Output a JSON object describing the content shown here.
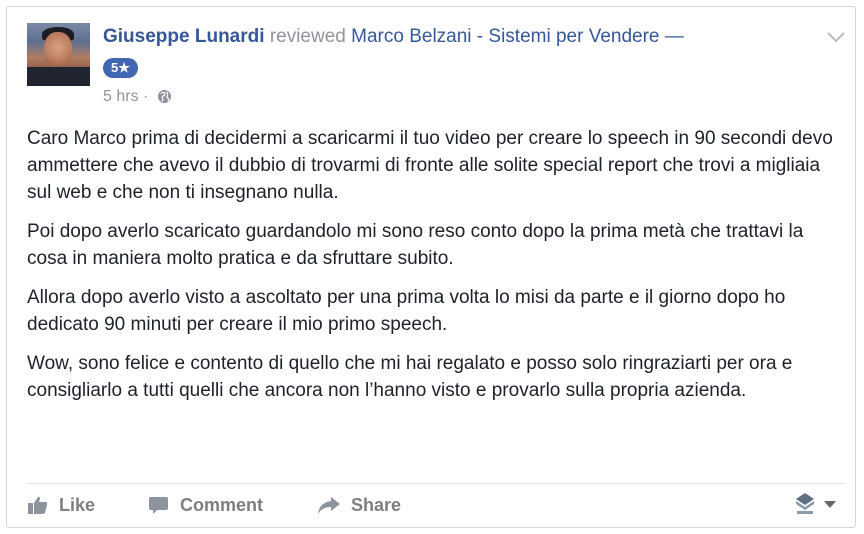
{
  "post": {
    "author": "Giuseppe Lunardi",
    "verb": "reviewed",
    "page_name": "Marco Belzani - Sistemi per Vendere —",
    "rating_badge": "5★",
    "timestamp": "5 hrs",
    "separator": "·",
    "privacy_icon": "globe-icon"
  },
  "review": {
    "paragraphs": [
      "Caro Marco prima di decidermi a scaricarmi il tuo video per creare lo speech in 90 secondi devo ammettere che avevo il dubbio di trovarmi di fronte alle solite special report che trovi a migliaia sul web e che non ti insegnano nulla.",
      "Poi dopo averlo scaricato guardandolo mi sono reso conto dopo la prima metà che trattavi la cosa in maniera molto pratica e da sfruttare subito.",
      "Allora dopo averlo visto a ascoltato per una prima volta lo misi da parte e il giorno dopo ho dedicato 90 minuti per creare il mio primo speech.",
      "Wow, sono felice e contento di quello che mi hai regalato e posso solo ringraziarti per ora e consigliarlo a tutti quelli che ancora non l’hanno visto e provarlo sulla propria azienda."
    ]
  },
  "actions": {
    "like_label": "Like",
    "comment_label": "Comment",
    "share_label": "Share"
  },
  "colors": {
    "link": "#365899",
    "muted": "#90949c",
    "badge": "#4267b2",
    "text": "#1d2129",
    "action": "#7f7f7f"
  }
}
